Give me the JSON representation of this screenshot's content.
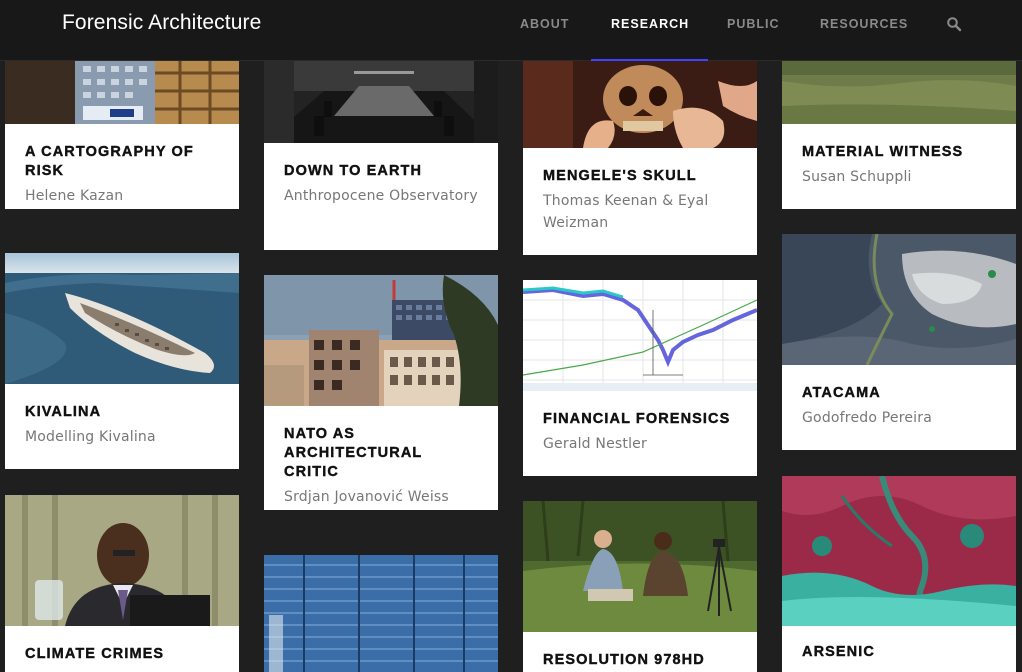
{
  "header": {
    "site_title": "Forensic Architecture",
    "nav": [
      {
        "label": "ABOUT",
        "active": false
      },
      {
        "label": "RESEARCH",
        "active": true
      },
      {
        "label": "PUBLIC",
        "active": false
      },
      {
        "label": "RESOURCES",
        "active": false
      }
    ],
    "search_icon": "search-icon",
    "accent_color": "#3a46ff"
  },
  "cards": [
    {
      "title": "A CARTOGRAPHY OF RISK",
      "author": "Helene Kazan",
      "image": "building-facade"
    },
    {
      "title": "DOWN TO EARTH",
      "author": "Anthropocene Observatory",
      "image": "conference-room"
    },
    {
      "title": "MENGELE'S SKULL",
      "author": "Thomas Keenan & Eyal Weizman",
      "image": "skull"
    },
    {
      "title": "MATERIAL WITNESS",
      "author": "Susan Schuppli",
      "image": "grass-field"
    },
    {
      "title": "KIVALINA",
      "author": "Modelling Kivalina",
      "image": "island-aerial"
    },
    {
      "title": "NATO AS ARCHITECTURAL CRITIC",
      "author": "Srdjan Jovanović Weiss",
      "image": "damaged-building"
    },
    {
      "title": "FINANCIAL FORENSICS",
      "author": "Gerald Nestler",
      "image": "financial-graph"
    },
    {
      "title": "ATACAMA",
      "author": "Godofredo Pereira",
      "image": "satellite-desert"
    },
    {
      "title": "CLIMATE CRIMES",
      "author": "",
      "image": "speaker-portrait"
    },
    {
      "title": "",
      "author": "",
      "image": "data-grid"
    },
    {
      "title": "RESOLUTION 978HD",
      "author": "",
      "image": "men-in-grass"
    },
    {
      "title": "ARSENIC",
      "author": "",
      "image": "satellite-delta"
    }
  ]
}
